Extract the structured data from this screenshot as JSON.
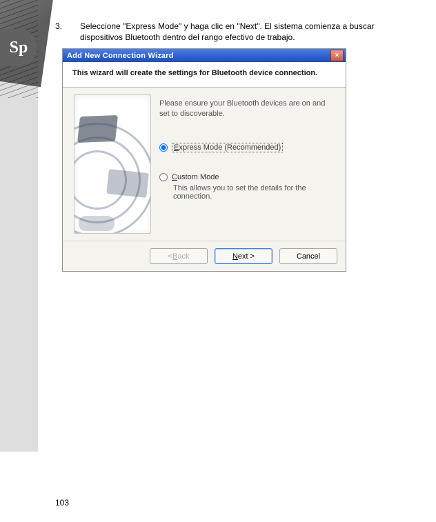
{
  "page_number": "103",
  "step": {
    "number": "3.",
    "text": "Seleccione \"Express Mode\" y haga clic en \"Next\". El sistema comienza a buscar dispositivos Bluetooth dentro del rango efectivo de trabajo."
  },
  "ribbon_label": "Sp",
  "wizard": {
    "title": "Add New Connection Wizard",
    "close_glyph": "×",
    "heading": "This wizard will create the settings for Bluetooth device connection.",
    "hint": "Please ensure your Bluetooth devices are on and set to discoverable.",
    "express": {
      "pre": "E",
      "rest": "xpress Mode (Recommended)"
    },
    "custom": {
      "pre": "C",
      "rest": "ustom Mode"
    },
    "custom_detail": "This allows you to set the details for the connection.",
    "buttons": {
      "back": {
        "pre": "< ",
        "u": "B",
        "rest": "ack"
      },
      "next": {
        "u": "N",
        "rest": "ext >"
      },
      "cancel": "Cancel"
    }
  }
}
